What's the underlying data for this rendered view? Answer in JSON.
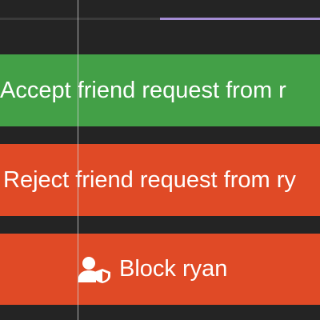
{
  "progress": {
    "fraction_complete": 0.5,
    "fill_color": "#a48cd4",
    "track_color": "#3a3a3a"
  },
  "actions": {
    "accept": {
      "label": "Accept friend request from r",
      "color": "#43a047"
    },
    "reject": {
      "label": "Reject friend request from ry",
      "color": "#e04a26"
    },
    "block": {
      "label": "Block ryan",
      "color": "#e04a26",
      "icon": "user-shield-icon"
    }
  }
}
